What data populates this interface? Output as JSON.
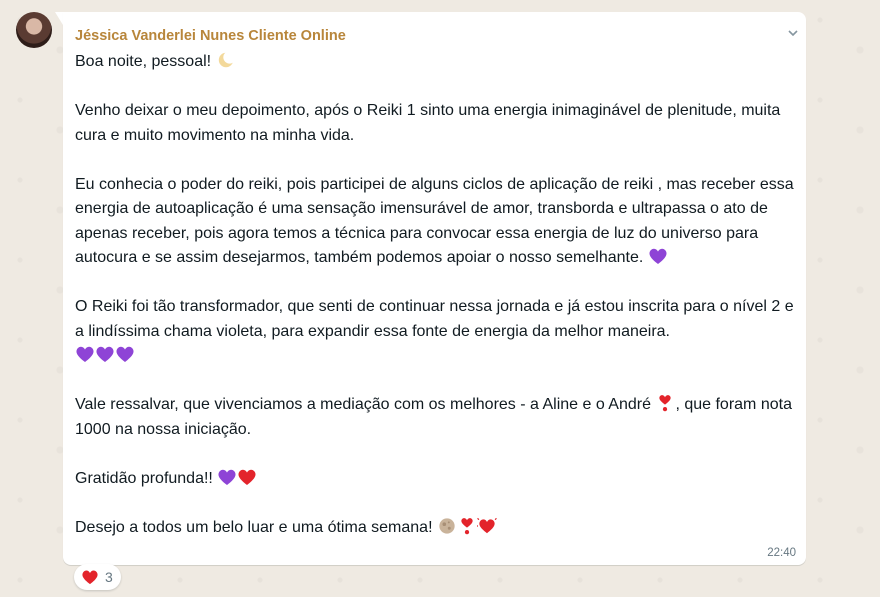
{
  "message": {
    "sender": "Jéssica Vanderlei Nunes Cliente Online",
    "time": "22:40",
    "lines": {
      "greeting": "Boa noite, pessoal!",
      "p1": "Venho deixar o meu depoimento, após o Reiki 1 sinto uma energia inimaginável de plenitude, muita cura e muito movimento na minha vida.",
      "p2": "Eu conhecia o poder do reiki, pois participei de alguns ciclos de aplicação de reiki , mas receber essa energia de autoaplicação é uma sensação imensurável de amor, transborda e ultrapassa o ato de apenas receber, pois agora temos a técnica para convocar essa energia de luz do universo para autocura e se assim desejarmos, também podemos apoiar o nosso semelhante.",
      "p3": "O Reiki foi tão transformador, que senti de continuar nessa jornada e já estou inscrita para o nível 2 e a lindíssima chama violeta, para expandir essa fonte de energia da melhor maneira.",
      "p4a": "Vale ressalvar, que vivenciamos a mediação com os melhores - a Aline e o André",
      "p4b": ", que foram nota 1000 na nossa iniciação.",
      "p5": "Gratidão profunda!!",
      "p6": "Desejo a todos um belo luar e uma ótima semana!"
    },
    "emojis": {
      "crescent_moon": "🌙",
      "purple_heart": "💜",
      "red_heart": "❤️",
      "exclamation": "❣️",
      "full_moon": "🌕",
      "growing_heart": "💓"
    }
  },
  "reaction": {
    "emoji": "❤️",
    "count": "3"
  },
  "colors": {
    "sender": "#b8863b",
    "background": "#efeae2",
    "bubble": "#ffffff",
    "purple_heart": "#8e44d6",
    "red_heart": "#e3242b"
  }
}
